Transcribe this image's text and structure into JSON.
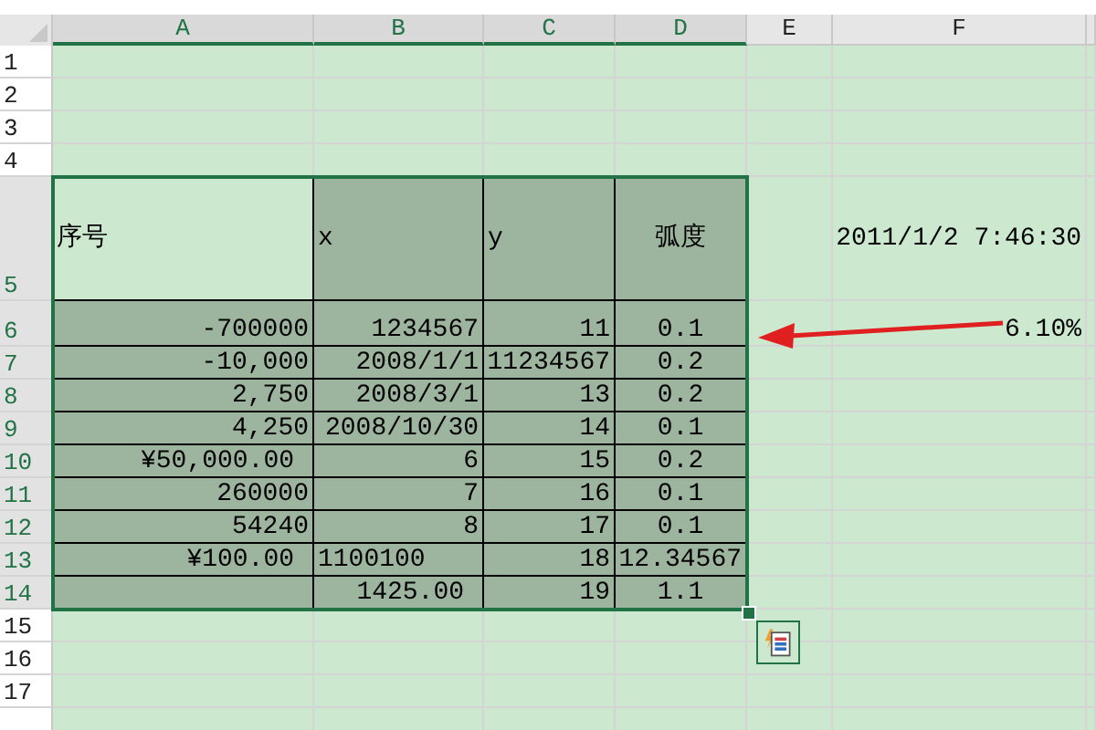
{
  "columns": [
    {
      "label": "A",
      "selected": true
    },
    {
      "label": "B",
      "selected": true
    },
    {
      "label": "C",
      "selected": true
    },
    {
      "label": "D",
      "selected": true
    },
    {
      "label": "E",
      "selected": false
    },
    {
      "label": "F",
      "selected": false
    }
  ],
  "rows": [
    {
      "label": "1",
      "selected": false
    },
    {
      "label": "2",
      "selected": false
    },
    {
      "label": "3",
      "selected": false
    },
    {
      "label": "4",
      "selected": false
    },
    {
      "label": "5",
      "selected": true,
      "cells": [
        {
          "text": "序号",
          "kind": "text",
          "shaded": false
        },
        {
          "text": "x",
          "kind": "text",
          "shaded": true
        },
        {
          "text": "y",
          "kind": "text",
          "shaded": true
        },
        {
          "text": "弧度",
          "kind": "center",
          "shaded": true
        }
      ],
      "note": "2011/1/2 7:46:30"
    },
    {
      "label": "6",
      "selected": true,
      "cells": [
        {
          "text": "-700000",
          "kind": "number",
          "shaded": true
        },
        {
          "text": "1234567",
          "kind": "number",
          "shaded": true
        },
        {
          "text": "11",
          "kind": "number",
          "shaded": true
        },
        {
          "text": "0.1",
          "kind": "center",
          "shaded": true
        }
      ],
      "note": "6.10%"
    },
    {
      "label": "7",
      "selected": true,
      "cells": [
        {
          "text": "-10,000",
          "kind": "number",
          "shaded": true
        },
        {
          "text": "2008/1/1",
          "kind": "number",
          "shaded": true
        },
        {
          "text": "11234567",
          "kind": "number",
          "shaded": true
        },
        {
          "text": "0.2",
          "kind": "center",
          "shaded": true
        }
      ]
    },
    {
      "label": "8",
      "selected": true,
      "cells": [
        {
          "text": "2,750",
          "kind": "number",
          "shaded": true
        },
        {
          "text": "2008/3/1",
          "kind": "number",
          "shaded": true
        },
        {
          "text": "13",
          "kind": "number",
          "shaded": true
        },
        {
          "text": "0.2",
          "kind": "center",
          "shaded": true
        }
      ]
    },
    {
      "label": "9",
      "selected": true,
      "cells": [
        {
          "text": "4,250",
          "kind": "number",
          "shaded": true
        },
        {
          "text": "2008/10/30",
          "kind": "number",
          "shaded": true
        },
        {
          "text": "14",
          "kind": "number",
          "shaded": true
        },
        {
          "text": "0.1",
          "kind": "center",
          "shaded": true
        }
      ]
    },
    {
      "label": "10",
      "selected": true,
      "cells": [
        {
          "text": "¥50,000.00",
          "kind": "accounting",
          "shaded": true
        },
        {
          "text": "6",
          "kind": "number",
          "shaded": true
        },
        {
          "text": "15",
          "kind": "number",
          "shaded": true
        },
        {
          "text": "0.2",
          "kind": "center",
          "shaded": true
        }
      ]
    },
    {
      "label": "11",
      "selected": true,
      "cells": [
        {
          "text": "260000",
          "kind": "number",
          "shaded": true
        },
        {
          "text": "7",
          "kind": "number",
          "shaded": true
        },
        {
          "text": "16",
          "kind": "number",
          "shaded": true
        },
        {
          "text": "0.1",
          "kind": "center",
          "shaded": true
        }
      ]
    },
    {
      "label": "12",
      "selected": true,
      "cells": [
        {
          "text": "54240",
          "kind": "number",
          "shaded": true
        },
        {
          "text": "8",
          "kind": "number",
          "shaded": true
        },
        {
          "text": "17",
          "kind": "number",
          "shaded": true
        },
        {
          "text": "0.1",
          "kind": "center",
          "shaded": true
        }
      ]
    },
    {
      "label": "13",
      "selected": true,
      "cells": [
        {
          "text": "¥100.00",
          "kind": "accounting",
          "shaded": true
        },
        {
          "text": "1100100",
          "kind": "text",
          "shaded": true
        },
        {
          "text": "18",
          "kind": "number",
          "shaded": true
        },
        {
          "text": "12.34567",
          "kind": "number",
          "shaded": true
        }
      ]
    },
    {
      "label": "14",
      "selected": true,
      "cells": [
        {
          "kind": "empty",
          "shaded": true
        },
        {
          "text": "1425.00",
          "kind": "accounting",
          "shaded": true
        },
        {
          "text": "19",
          "kind": "number",
          "shaded": true
        },
        {
          "text": "1.1",
          "kind": "center",
          "shaded": true
        }
      ]
    },
    {
      "label": "15",
      "selected": false
    },
    {
      "label": "16",
      "selected": false
    },
    {
      "label": "17",
      "selected": false
    }
  ]
}
